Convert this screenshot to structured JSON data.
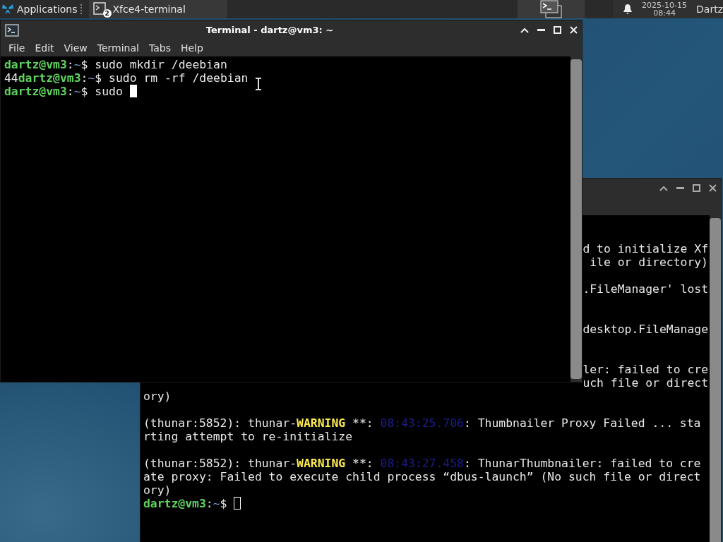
{
  "panel": {
    "menu_label": "Applications",
    "task": {
      "label": "Xfce4-terminal",
      "badge": "2"
    },
    "clock": {
      "date": "2025-10-15",
      "time": "08:44"
    },
    "user": "Dartz"
  },
  "front_window": {
    "title": "Terminal - dartz@vm3: ~",
    "menu": [
      "File",
      "Edit",
      "View",
      "Terminal",
      "Tabs",
      "Help"
    ],
    "lines": [
      {
        "segments": [
          {
            "text": "dartz@vm3",
            "kind": "user"
          },
          {
            "text": ":",
            "kind": "plain"
          },
          {
            "text": "~",
            "kind": "path"
          },
          {
            "text": "$ sudo mkdir /deebian",
            "kind": "plain"
          }
        ]
      },
      {
        "segments": [
          {
            "text": "44",
            "kind": "plain"
          },
          {
            "text": "dartz@vm3",
            "kind": "user"
          },
          {
            "text": ":",
            "kind": "plain"
          },
          {
            "text": "~",
            "kind": "path"
          },
          {
            "text": "$ sudo rm -rf /deebian",
            "kind": "plain"
          }
        ]
      },
      {
        "segments": [
          {
            "text": "dartz@vm3",
            "kind": "user"
          },
          {
            "text": ":",
            "kind": "plain"
          },
          {
            "text": "~",
            "kind": "path"
          },
          {
            "text": "$ sudo ",
            "kind": "plain"
          }
        ],
        "cursor": {
          "filled": true
        }
      }
    ]
  },
  "back_window": {
    "lines": [
      {
        "kind": "blank"
      },
      {
        "kind": "blank"
      },
      {
        "kind": "clipped",
        "text": "d to initialize Xf"
      },
      {
        "kind": "clipped",
        "text": "ile or directory)"
      },
      {
        "kind": "blank"
      },
      {
        "kind": "clipped",
        "text": ".FileManager' lost"
      },
      {
        "kind": "blank"
      },
      {
        "kind": "blank"
      },
      {
        "kind": "clipped",
        "text": "desktop.FileManage"
      },
      {
        "kind": "blank"
      },
      {
        "kind": "blank"
      },
      {
        "kind": "clipped",
        "text": "ler: failed to cre"
      },
      {
        "kind": "clipped",
        "text": "uch file or direct"
      },
      {
        "kind": "full",
        "segments": [
          {
            "text": "ory)",
            "kind": "plain"
          }
        ]
      },
      {
        "kind": "blank"
      },
      {
        "kind": "full",
        "segments": [
          {
            "text": "(thunar:5852): thunar-",
            "kind": "plain"
          },
          {
            "text": "WARNING",
            "kind": "warning"
          },
          {
            "text": " **: ",
            "kind": "plain"
          },
          {
            "text": "08:43:25.706",
            "kind": "time"
          },
          {
            "text": ": Thumbnailer Proxy Failed ... sta",
            "kind": "plain"
          }
        ]
      },
      {
        "kind": "full",
        "segments": [
          {
            "text": "rting attempt to re-initialize",
            "kind": "plain"
          }
        ]
      },
      {
        "kind": "blank"
      },
      {
        "kind": "full",
        "segments": [
          {
            "text": "(thunar:5852): thunar-",
            "kind": "plain"
          },
          {
            "text": "WARNING",
            "kind": "warning"
          },
          {
            "text": " **: ",
            "kind": "plain"
          },
          {
            "text": "08:43:27.458",
            "kind": "time"
          },
          {
            "text": ": ThunarThumbnailer: failed to cre",
            "kind": "plain"
          }
        ]
      },
      {
        "kind": "full",
        "segments": [
          {
            "text": "ate proxy: Failed to execute child process “dbus-launch” (No such file or direct",
            "kind": "plain"
          }
        ]
      },
      {
        "kind": "full",
        "segments": [
          {
            "text": "ory)",
            "kind": "plain"
          }
        ]
      },
      {
        "kind": "full",
        "segments": [
          {
            "text": "dartz@vm3",
            "kind": "user"
          },
          {
            "text": ":",
            "kind": "plain"
          },
          {
            "text": "~",
            "kind": "path"
          },
          {
            "text": "$ ",
            "kind": "plain"
          }
        ],
        "cursor": {
          "filled": false
        }
      }
    ]
  }
}
